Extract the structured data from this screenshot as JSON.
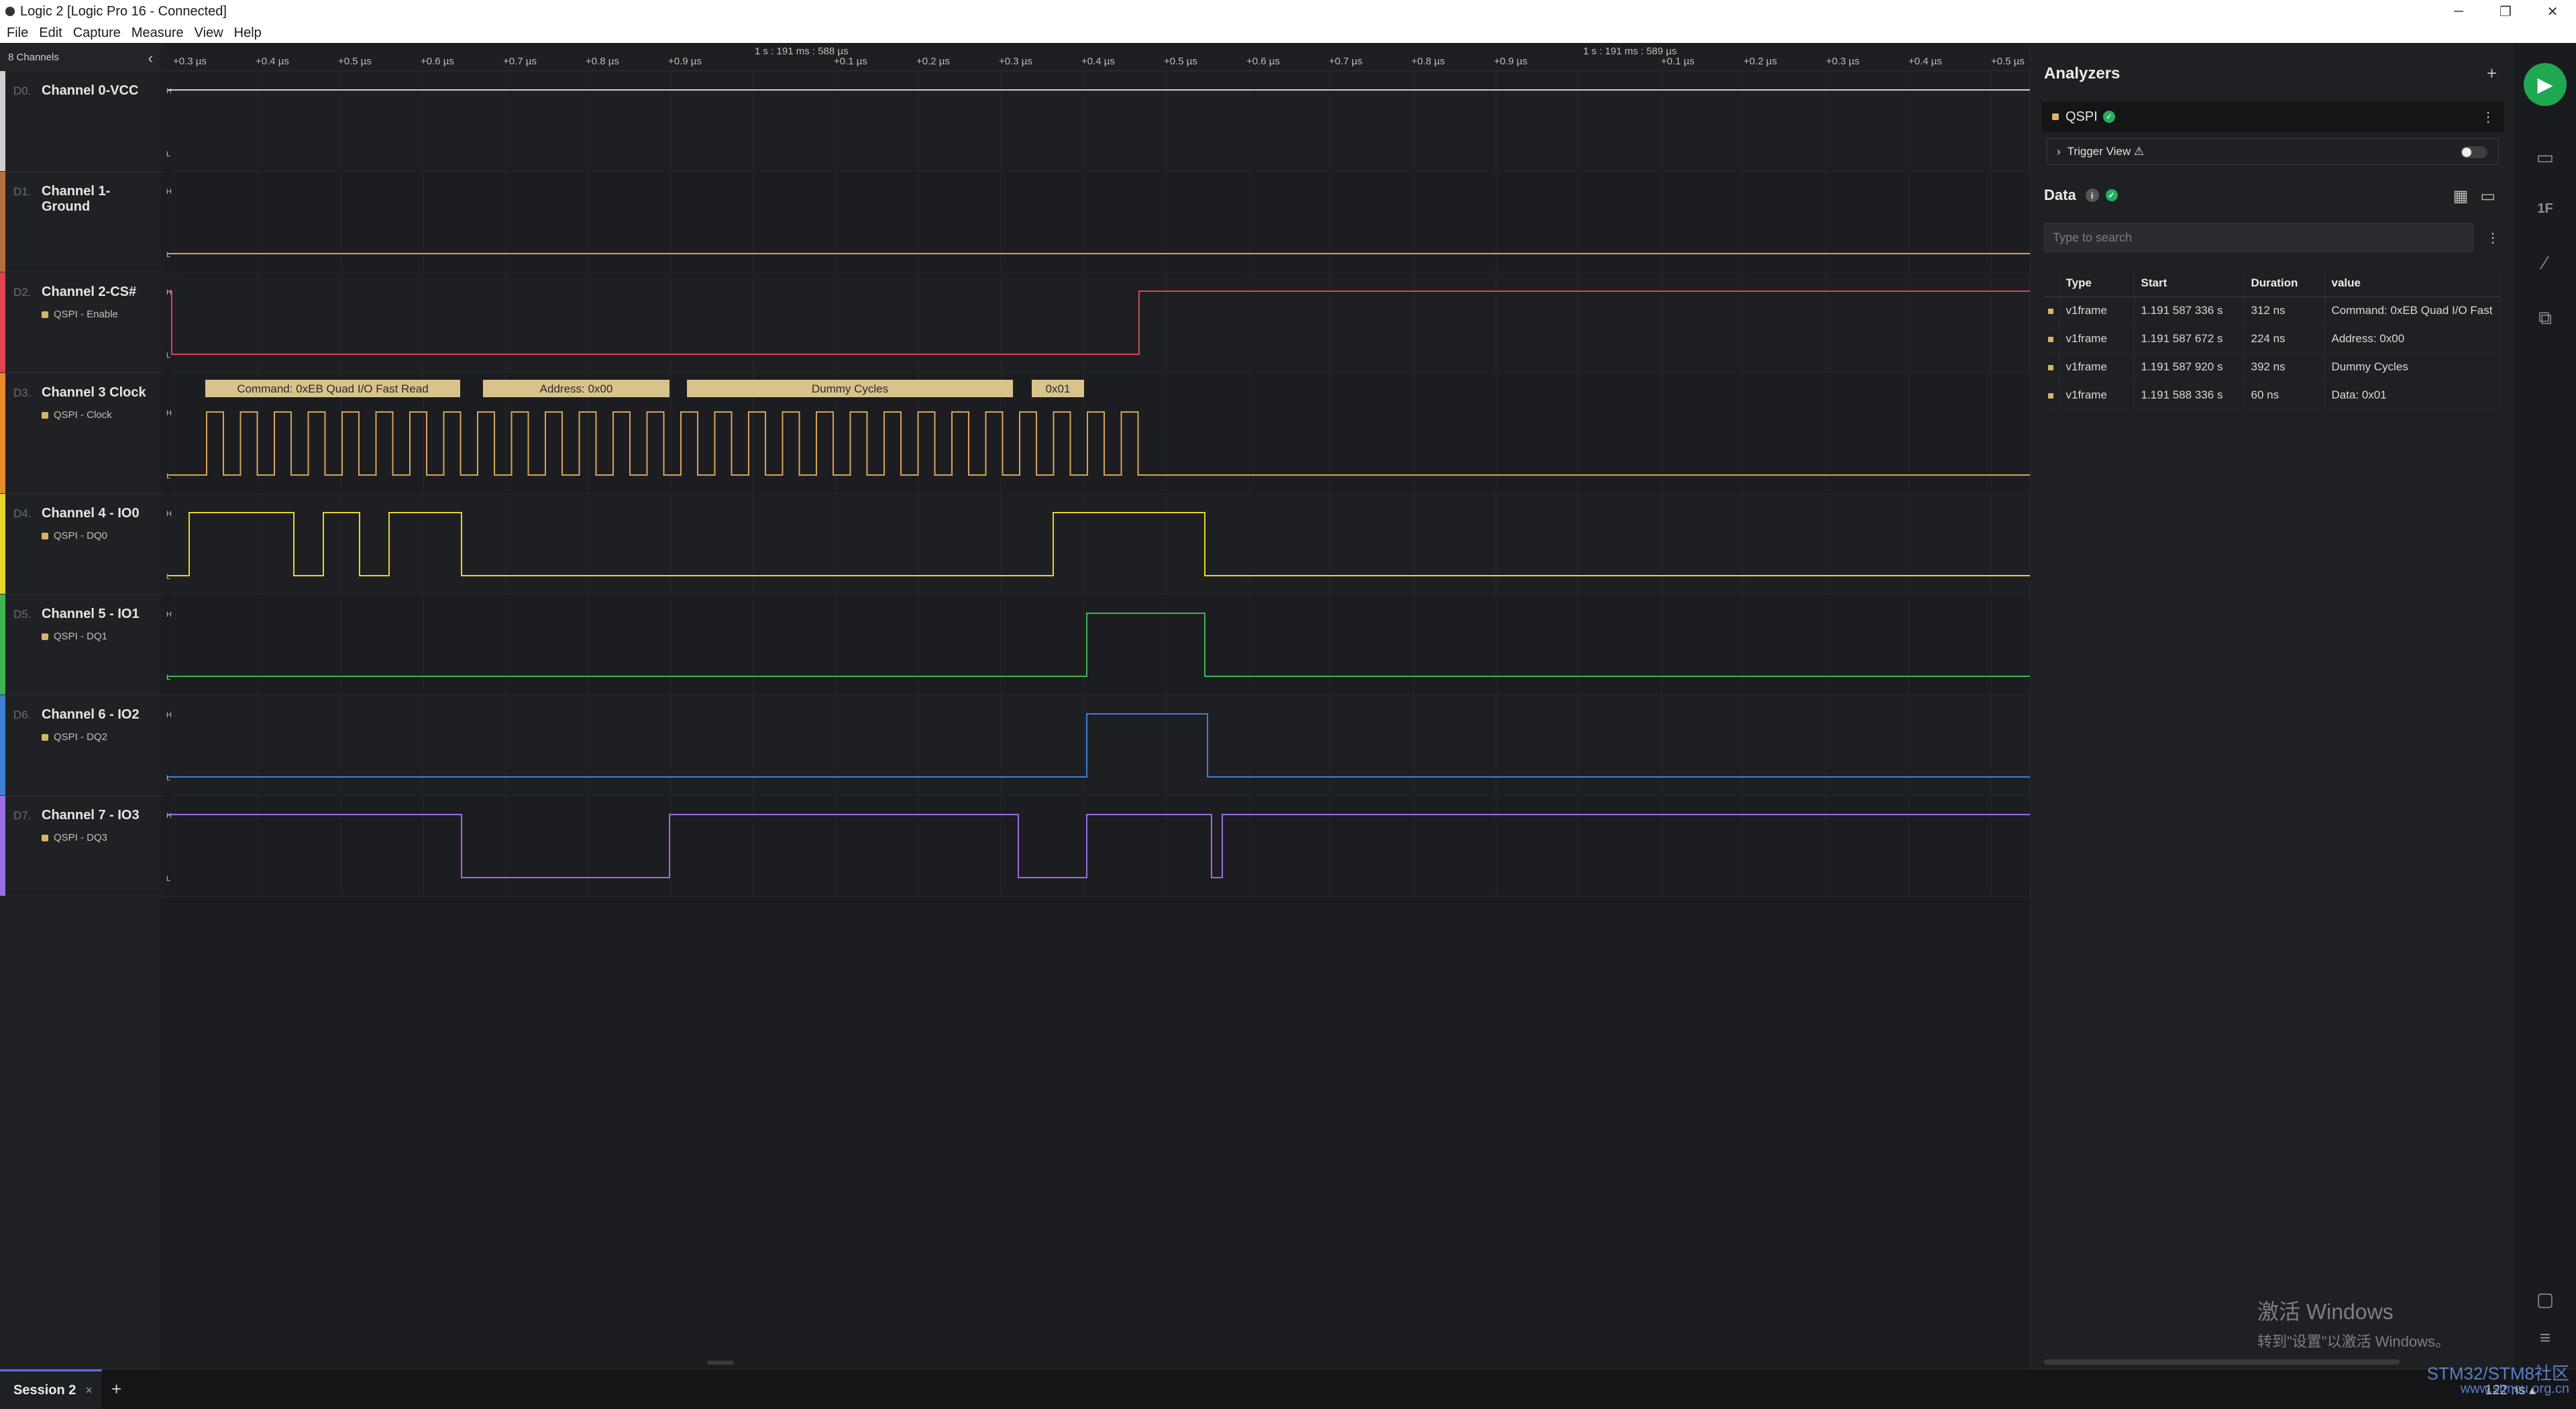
{
  "window": {
    "title": "Logic 2 [Logic Pro 16 - Connected]",
    "minimize": "─",
    "maximize": "❐",
    "close": "✕"
  },
  "menu": [
    "File",
    "Edit",
    "Capture",
    "Measure",
    "View",
    "Help"
  ],
  "channels_header": {
    "label": "8 Channels",
    "collapse_icon": "‹"
  },
  "channels": [
    {
      "id": "D0.",
      "name": "Channel 0-VCC",
      "tag": "",
      "color": "#d0d0d0"
    },
    {
      "id": "D1.",
      "name": "Channel 1- Ground",
      "tag": "",
      "color": "#b5703f"
    },
    {
      "id": "D2.",
      "name": "Channel 2-CS#",
      "tag": "QSPI - Enable",
      "color": "#e0444f"
    },
    {
      "id": "D3.",
      "name": "Channel 3 Clock",
      "tag": "QSPI - Clock",
      "color": "#e88a2d"
    },
    {
      "id": "D4.",
      "name": "Channel 4 - IO0",
      "tag": "QSPI - DQ0",
      "color": "#e6d52c"
    },
    {
      "id": "D5.",
      "name": "Channel 5 - IO1",
      "tag": "QSPI - DQ1",
      "color": "#3fb553"
    },
    {
      "id": "D6.",
      "name": "Channel 6 - IO2",
      "tag": "QSPI - DQ2",
      "color": "#3f7fd6"
    },
    {
      "id": "D7.",
      "name": "Channel 7 - IO3",
      "tag": "QSPI - DQ3",
      "color": "#9a6ee0"
    }
  ],
  "ruler": {
    "ticks_left": [
      "+0.3 µs",
      "+0.4 µs",
      "+0.5 µs",
      "+0.6 µs",
      "+0.7 µs",
      "+0.8 µs",
      "+0.9 µs"
    ],
    "marker_left": "1 s : 191 ms : 588 µs",
    "ticks_mid": [
      "+0.1 µs",
      "+0.2 µs",
      "+0.3 µs",
      "+0.4 µs",
      "+0.5 µs",
      "+0.6 µs",
      "+0.7 µs",
      "+0.8 µs",
      "+0.9 µs"
    ],
    "marker_right": "1 s : 191 ms : 589 µs",
    "ticks_right": [
      "+0.1 µs",
      "+0.2 µs",
      "+0.3 µs",
      "+0.4 µs",
      "+0.5 µs"
    ]
  },
  "level_labels": {
    "high": "H",
    "low": "L"
  },
  "annotations": [
    "Command: 0xEB Quad I/O Fast Read",
    "Address: 0x00",
    "Dummy Cycles",
    "0x01"
  ],
  "analyzers": {
    "title": "Analyzers",
    "add_icon": "+",
    "items": [
      {
        "name": "QSPI",
        "status_icon": "✓",
        "more_icon": "⋮"
      }
    ],
    "trigger_view": {
      "label": "Trigger View ⚠",
      "chevron": "›",
      "enabled": false
    }
  },
  "data_panel": {
    "title": "Data",
    "info_icon": "i",
    "status_icon": "✓",
    "table_icon": "▦",
    "terminal_icon": "▭",
    "search_placeholder": "Type to search",
    "search_more": "⋮",
    "columns": [
      "Type",
      "Start",
      "Duration",
      "value"
    ],
    "rows": [
      {
        "type": "v1frame",
        "start": "1.191 587 336 s",
        "duration": "312 ns",
        "value": "Command: 0xEB Quad I/O Fast"
      },
      {
        "type": "v1frame",
        "start": "1.191 587 672 s",
        "duration": "224 ns",
        "value": "Address: 0x00"
      },
      {
        "type": "v1frame",
        "start": "1.191 587 920 s",
        "duration": "392 ns",
        "value": "Dummy Cycles"
      },
      {
        "type": "v1frame",
        "start": "1.191 588 336 s",
        "duration": "60 ns",
        "value": "Data: 0x01"
      }
    ]
  },
  "watermark": {
    "line1": "激活 Windows",
    "line2": "转到\"设置\"以激活 Windows。"
  },
  "rail": {
    "play_icon": "▶",
    "icons": [
      "▭",
      "1F",
      "⁄",
      "⧉",
      "▢",
      "≡"
    ]
  },
  "bottom": {
    "session_tab": "Session 2",
    "close": "×",
    "add": "+",
    "timescale": "122 ns ▴"
  },
  "brand": {
    "line1": "STM32/STM8社区",
    "line2": "www.stmcu.org.cn"
  }
}
